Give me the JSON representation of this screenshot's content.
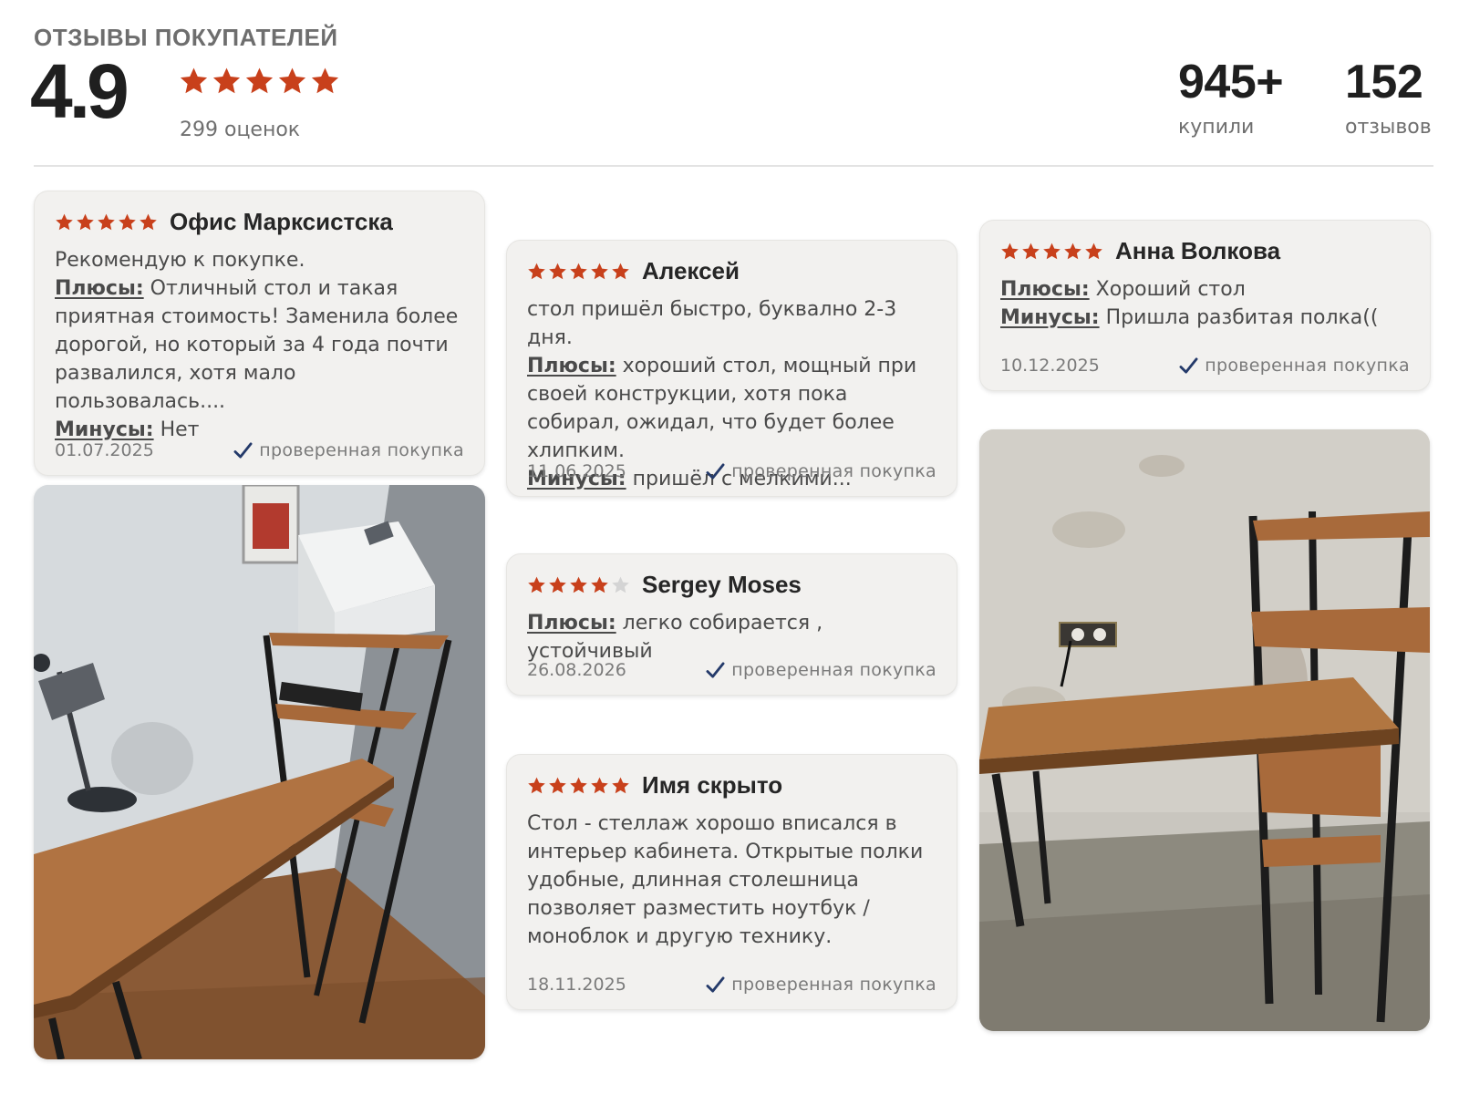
{
  "header": {
    "title": "ОТЗЫВЫ ПОКУПАТЕЛЕЙ",
    "rating": "4.9",
    "rating_stars": 5,
    "ratings_count": "299 оценок",
    "bought_value": "945+",
    "bought_label": "купили",
    "reviews_value": "152",
    "reviews_label": "отзывов"
  },
  "colors": {
    "star_filled": "#c8401b",
    "star_empty": "#d4d4d4",
    "check": "#243a6a",
    "card_bg": "#f2f1ef"
  },
  "reviews": [
    {
      "stars": 5,
      "author": "Офис Марксистска",
      "intro": "Рекомендую к покупке.",
      "pros_label": "Плюсы:",
      "pros": "Отличный стол и такая приятная стоимость! Заменила более дорогой, но который за 4 года почти развалился, хотя мало пользовалась....",
      "cons_label": "Минусы:",
      "cons": "Нет",
      "date": "01.07.2025",
      "verified": "проверенная покупка"
    },
    {
      "stars": 5,
      "author": "Алексей",
      "intro": "стол пришёл быстро, буквално 2-3 дня.",
      "pros_label": "Плюсы:",
      "pros": "хороший стол, мощный при своей конструкции, хотя пока собирал, ожидал, что будет более хлипким.",
      "cons_label": "Минусы:",
      "cons": "пришёл с мелкими...",
      "date": "11.06.2025",
      "verified": "проверенная покупка"
    },
    {
      "stars": 4,
      "author": "Sergey Moses",
      "pros_label": "Плюсы:",
      "pros": "легко собирается , устойчивый",
      "date": "26.08.2026",
      "verified": "проверенная покупка"
    },
    {
      "stars": 5,
      "author": "Имя скрыто",
      "text": "Стол - стеллаж хорошо вписался в интерьер кабинета. Открытые полки удобные, длинная столешница позволяет разместить ноутбук / моноблок и другую технику.",
      "date": "18.11.2025",
      "verified": "проверенная покупка"
    },
    {
      "stars": 5,
      "author": "Анна Волкова",
      "pros_label": "Плюсы:",
      "pros": "Хороший стол",
      "cons_label": "Минусы:",
      "cons": "Пришла разбитая полка((",
      "date": "10.12.2025",
      "verified": "проверенная покупка"
    }
  ]
}
